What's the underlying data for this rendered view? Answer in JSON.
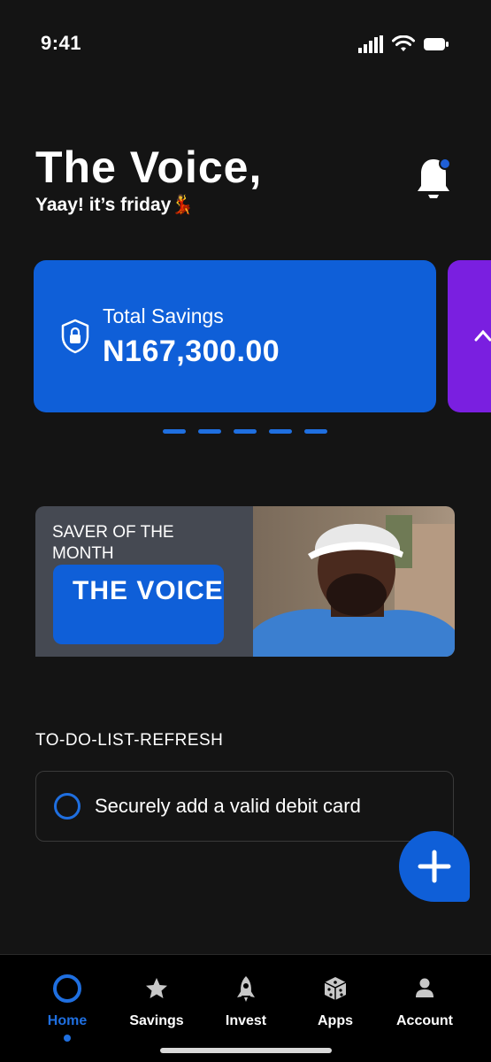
{
  "status_bar": {
    "time": "9:41"
  },
  "header": {
    "greeting": "The Voice,",
    "subgreeting": "Yaay! it’s friday💃"
  },
  "savings": {
    "label": "Total Savings",
    "amount": "N167,300.00",
    "page_count": 5
  },
  "saver_of_month": {
    "label": "SAVER OF THE MONTH",
    "name": "THE VOICE"
  },
  "todo": {
    "heading": "TO-DO-LIST-REFRESH",
    "items": [
      {
        "text": "Securely add a valid debit card"
      }
    ]
  },
  "nav": {
    "items": [
      {
        "label": "Home",
        "icon": "home-icon",
        "active": true
      },
      {
        "label": "Savings",
        "icon": "star-icon"
      },
      {
        "label": "Invest",
        "icon": "rocket-icon"
      },
      {
        "label": "Apps",
        "icon": "dice-icon"
      },
      {
        "label": "Account",
        "icon": "person-icon"
      }
    ]
  },
  "colors": {
    "background": "#141414",
    "primary_blue": "#0f5fd8",
    "purple_card": "#7a1fe0",
    "saver_card": "#454952"
  }
}
